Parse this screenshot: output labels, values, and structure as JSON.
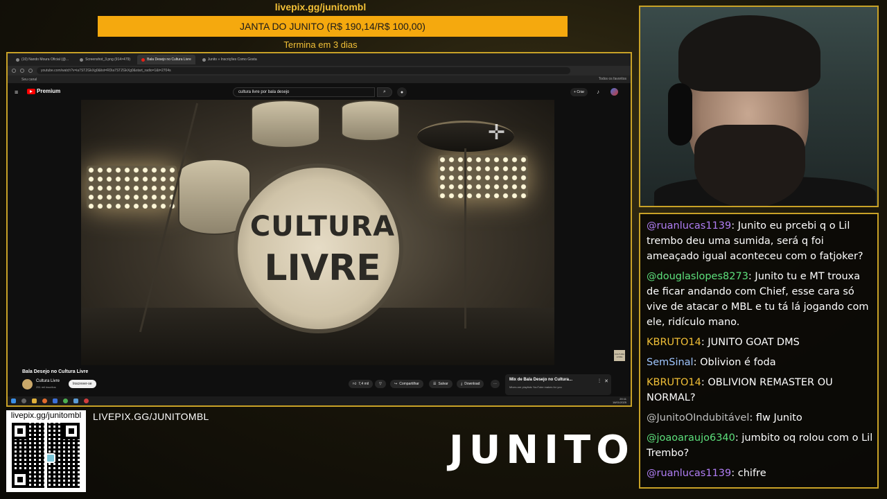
{
  "overlay": {
    "top_url": "livepix.gg/junitombl",
    "goal_label": "JANTA DO JUNITO (R$ 190,14/R$ 100,00)",
    "goal_ends": "Termina em 3 dias",
    "bottom_link": "LIVEPIX.GG/JUNITOMBL",
    "qr_caption": "livepix.gg/junitombl",
    "brand": "JUNITO",
    "accent_color": "#f5a90e",
    "border_color": "#c9a227"
  },
  "browser": {
    "tabs": [
      {
        "label": "(10) Nando Moura Oficial (@...",
        "active": false
      },
      {
        "label": "Screenshot_3.png (914×479)",
        "active": false
      },
      {
        "label": "Bala Desejo no Cultura Livre",
        "active": true
      },
      {
        "label": "Junito » Inscrições Como Gosta",
        "active": false
      }
    ],
    "url": "youtube.com/watch?v=ia7STZGkXg0&list=RDia7STZGkXg0&start_radio=1&t=2704s",
    "bookmark": "Seu canal",
    "bookmarks_right": "Todos os favoritos"
  },
  "youtube": {
    "brand": "Premium",
    "search_value": "cultura livre por bala desejo",
    "create_label": "Criar",
    "video": {
      "drum_text_1": "CULTURA",
      "drum_text_2": "LIVRE",
      "watermark": "CULTURA LIVRE",
      "title": "Bala Desejo no Cultura Livre",
      "channel": "Cultura Livre",
      "subscribers": "251 mil inscritos",
      "subscribe_label": "Inscrever-se",
      "likes": "7,4 mil",
      "share_label": "Compartilhar",
      "save_label": "Salvar",
      "download_label": "Download"
    },
    "mix": {
      "title": "Mix de Bala Desejo no Cultura...",
      "subtitle": "Mixes are playlists YouTube makes for you"
    }
  },
  "taskbar": {
    "time": "20:11",
    "date": "16/01/2025"
  },
  "chat": {
    "messages": [
      {
        "user": "@ruanlucas1139",
        "color": "#b07ef5",
        "text": ": Junito eu prcebi q o Lil trembo deu uma sumida, será q foi ameaçado igual aconteceu com o fatjoker?"
      },
      {
        "user": "@douglaslopes8273",
        "color": "#5de07c",
        "text": ": Junito tu e MT trouxa de ficar andando com Chief, esse cara só vive de atacar o MBL e tu tá lá jogando com ele, ridículo mano."
      },
      {
        "user": "KBRUTO14",
        "color": "#f2c037",
        "text": ": JUNITO GOAT DMS"
      },
      {
        "user": "SemSinal",
        "color": "#9fc6ff",
        "text": ": Oblivion é foda"
      },
      {
        "user": "KBRUTO14",
        "color": "#f2c037",
        "text": ": OBLIVION REMASTER OU NORMAL?"
      },
      {
        "user": "@JunitoOIndubitável",
        "color": "#bfbfbf",
        "text": ": flw Junito"
      },
      {
        "user": "@joaoaraujo6340",
        "color": "#5de07c",
        "text": ": jumbito oq rolou com o Lil Trembo?"
      },
      {
        "user": "@ruanlucas1139",
        "color": "#b07ef5",
        "text": ": chifre"
      }
    ]
  }
}
